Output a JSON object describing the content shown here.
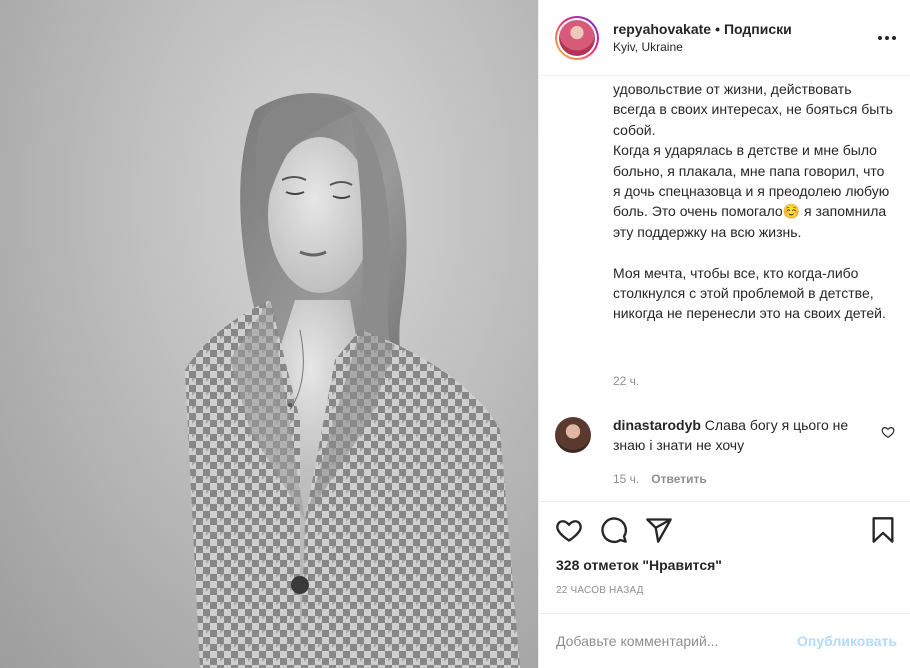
{
  "post": {
    "photo_alt_icon": "portrait-photo",
    "header": {
      "username": "repyahovakate",
      "separator": "•",
      "follow_label": "Подписки",
      "location": "Kyiv, Ukraine"
    },
    "caption": {
      "text": "удовольствие от жизни, действовать всегда в своих интересах, не бояться быть собой.\nКогда я ударялась в детстве и мне было больно, я плакала, мне папа говорил, что я дочь спецназовца и я преодолею любую боль. Это очень помогало☺️ я запомнила эту поддержку на всю жизнь.\n\nМоя мечта, чтобы все, кто когда-либо столкнулся с этой проблемой в детстве, никогда не перенесли это на своих детей.",
      "time": "22 ч."
    },
    "comment": {
      "username": "dinastarodyb",
      "text": "Слава богу я цього не знаю і знати не хочу",
      "time": "15 ч.",
      "reply_label": "Ответить"
    },
    "actions": {
      "likes_text": "328 отметок \"Нравится\"",
      "posted_ago": "22 часов назад",
      "icons": [
        "heart-icon",
        "comment-icon",
        "share-icon",
        "bookmark-icon"
      ]
    },
    "add_comment": {
      "placeholder": "Добавьте комментарий...",
      "publish_label": "Опубликовать"
    },
    "colors": {
      "border": "#efefef",
      "text": "#262626",
      "muted": "#8e8e8e",
      "publish_disabled": "#b3dbff"
    }
  }
}
